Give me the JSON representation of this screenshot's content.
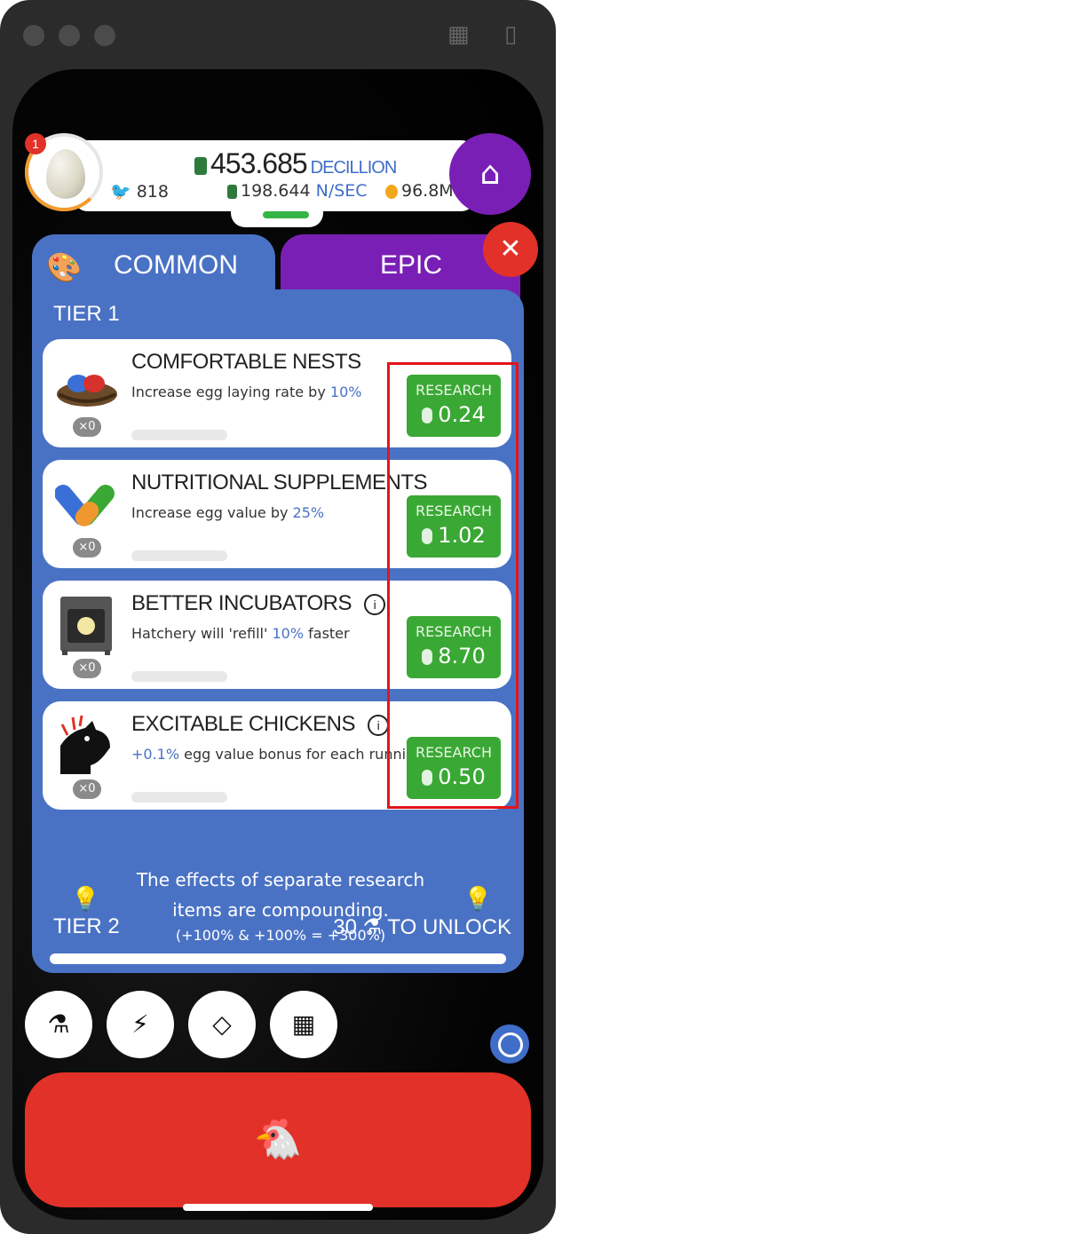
{
  "header": {
    "notification_count": "1",
    "money_value": "453.685",
    "money_unit": "DECILLION",
    "rate_value": "198.644",
    "rate_unit": "N/SEC",
    "chickens": "818",
    "golden_eggs": "96.8M"
  },
  "tabs": [
    {
      "label": "COMMON"
    },
    {
      "label": "EPIC"
    }
  ],
  "tier1": {
    "label": "TIER 1"
  },
  "research": [
    {
      "title": "COMFORTABLE NESTS",
      "desc_before": "Increase egg laying rate by",
      "desc_hl": "10%",
      "desc_after": "",
      "count": "×0",
      "button_label": "RESEARCH",
      "cost": "0.24",
      "icon": "nest-icon"
    },
    {
      "title": "NUTRITIONAL SUPPLEMENTS",
      "desc_before": "Increase egg value by",
      "desc_hl": "25%",
      "desc_after": "",
      "count": "×0",
      "button_label": "RESEARCH",
      "cost": "1.02",
      "icon": "pill-icon"
    },
    {
      "title": "BETTER INCUBATORS",
      "desc_before": "Hatchery will 'refill'",
      "desc_hl": "10%",
      "desc_after": "faster",
      "count": "×0",
      "button_label": "RESEARCH",
      "cost": "8.70",
      "icon": "incubator-icon"
    },
    {
      "title": "EXCITABLE CHICKENS",
      "desc_before": "",
      "desc_hl": "+0.1%",
      "desc_after": "egg value bonus for each running chicken",
      "count": "×0",
      "button_label": "RESEARCH",
      "cost": "0.50",
      "icon": "chicken-icon"
    }
  ],
  "tip": {
    "line": "The effects of separate research items are compounding.",
    "sub": "(+100% & +100% = +300%)"
  },
  "tier2": {
    "label": "TIER 2",
    "unlock_count": "30",
    "unlock_text": "TO UNLOCK"
  },
  "accent": {
    "blue": "#4a72c4",
    "purple": "#7a1fb5",
    "red": "#e23128",
    "green": "#3aa834"
  }
}
